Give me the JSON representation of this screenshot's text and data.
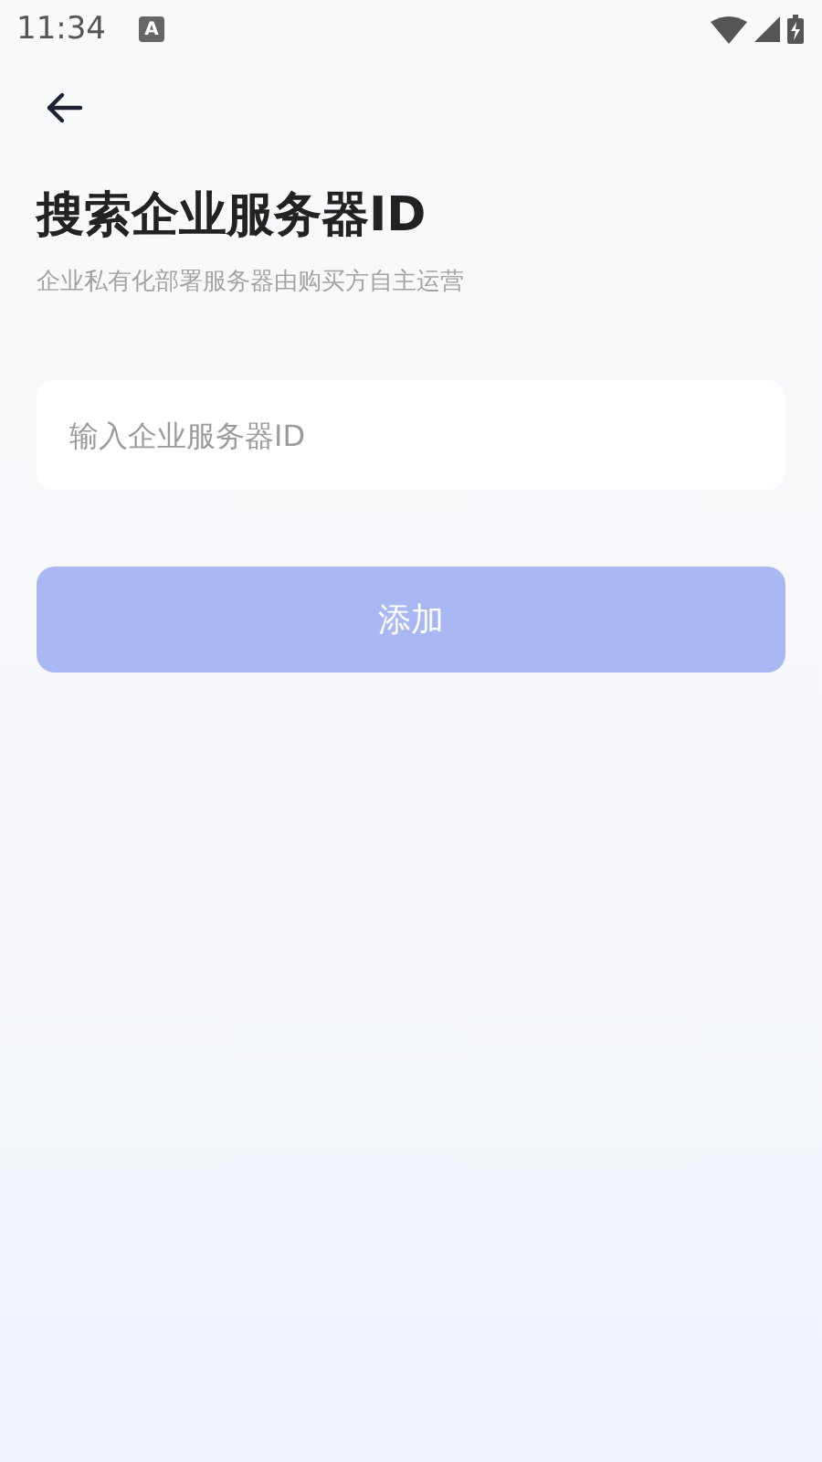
{
  "status_bar": {
    "time": "11:34",
    "notification": "A"
  },
  "title": "搜索企业服务器ID",
  "subtitle": "企业私有化部署服务器由购买方自主运营",
  "search": {
    "placeholder": "输入企业服务器ID"
  },
  "add_button": {
    "label": "添加",
    "disabled": true
  }
}
